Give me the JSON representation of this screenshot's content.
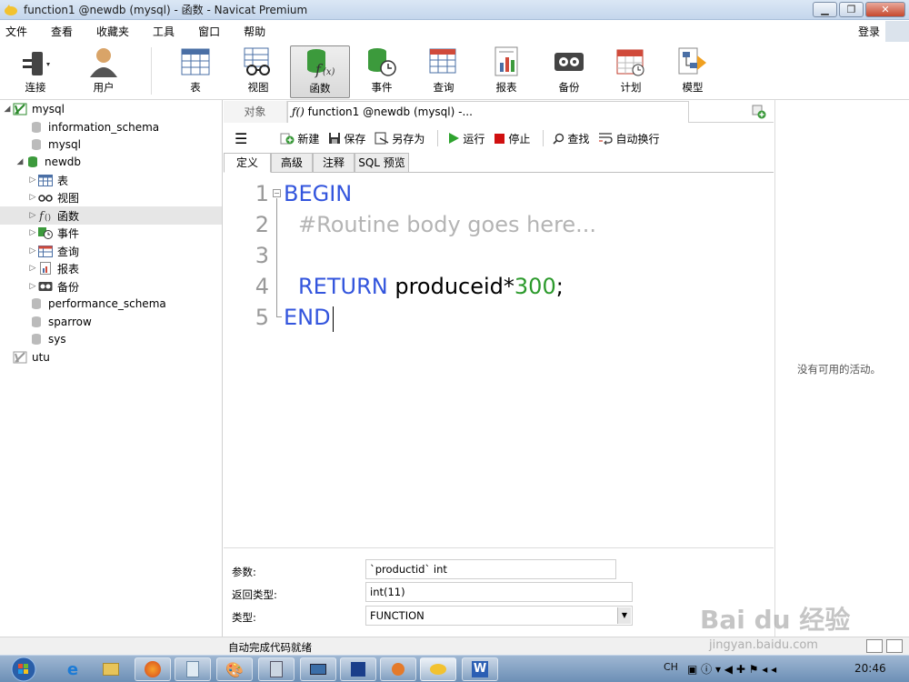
{
  "window": {
    "title": "function1 @newdb (mysql) - 函数 - Navicat Premium"
  },
  "menu": [
    "文件",
    "查看",
    "收藏夹",
    "工具",
    "窗口",
    "帮助"
  ],
  "login_label": "登录",
  "toolbar": [
    {
      "label": "连接",
      "icon": "connect-icon"
    },
    {
      "label": "用户",
      "icon": "user-icon"
    },
    {
      "label": "表",
      "icon": "table-icon"
    },
    {
      "label": "视图",
      "icon": "view-icon"
    },
    {
      "label": "函数",
      "icon": "function-icon",
      "active": true
    },
    {
      "label": "事件",
      "icon": "event-icon"
    },
    {
      "label": "查询",
      "icon": "query-icon"
    },
    {
      "label": "报表",
      "icon": "report-icon"
    },
    {
      "label": "备份",
      "icon": "backup-icon"
    },
    {
      "label": "计划",
      "icon": "schedule-icon"
    },
    {
      "label": "模型",
      "icon": "model-icon"
    }
  ],
  "tree": [
    {
      "label": "mysql",
      "level": 0,
      "expanded": true,
      "icon": "connection-icon"
    },
    {
      "label": "information_schema",
      "level": 1,
      "icon": "database-icon"
    },
    {
      "label": "mysql",
      "level": 1,
      "icon": "database-icon"
    },
    {
      "label": "newdb",
      "level": 1,
      "expanded": true,
      "icon": "database-icon"
    },
    {
      "label": "表",
      "level": 2,
      "icon": "table-icon"
    },
    {
      "label": "视图",
      "level": 2,
      "icon": "view-icon"
    },
    {
      "label": "函数",
      "level": 2,
      "icon": "function-icon",
      "selected": true
    },
    {
      "label": "事件",
      "level": 2,
      "icon": "event-icon"
    },
    {
      "label": "查询",
      "level": 2,
      "icon": "query-icon"
    },
    {
      "label": "报表",
      "level": 2,
      "icon": "report-icon"
    },
    {
      "label": "备份",
      "level": 2,
      "icon": "backup-icon"
    },
    {
      "label": "performance_schema",
      "level": 1,
      "icon": "database-icon"
    },
    {
      "label": "sparrow",
      "level": 1,
      "icon": "database-icon"
    },
    {
      "label": "sys",
      "level": 1,
      "icon": "database-icon"
    },
    {
      "label": "utu",
      "level": 0,
      "icon": "connection-icon"
    }
  ],
  "tabs": {
    "objects": "对象",
    "active": "function1 @newdb (mysql) -..."
  },
  "editor_toolbar": {
    "new": "新建",
    "save": "保存",
    "save_as": "另存为",
    "run": "运行",
    "stop": "停止",
    "find": "查找",
    "wrap": "自动换行"
  },
  "subtabs": [
    "定义",
    "高级",
    "注释",
    "SQL 预览"
  ],
  "code": {
    "line_numbers": [
      "1",
      "2",
      "3",
      "4",
      "5"
    ],
    "begin": "BEGIN",
    "comment": "#Routine body goes here...",
    "ret_kw": "RETURN",
    "ret_expr": " produceid*",
    "ret_num": "300",
    "ret_end": ";",
    "end": "END"
  },
  "props": {
    "params_label": "参数:",
    "params_value": "`productid` int",
    "return_label": "返回类型:",
    "return_value": "int(11)",
    "type_label": "类型:",
    "type_value": "FUNCTION"
  },
  "right_panel_msg": "没有可用的活动。",
  "status_text": "自动完成代码就绪",
  "taskbar": {
    "ime": "CH",
    "clock": "20:46"
  },
  "watermark": {
    "brand": "Bai du 经验",
    "url": "jingyan.baidu.com"
  },
  "colors": {
    "keyword": "#3355dd",
    "comment": "#b4b4b4",
    "number": "#2c9a2c"
  }
}
